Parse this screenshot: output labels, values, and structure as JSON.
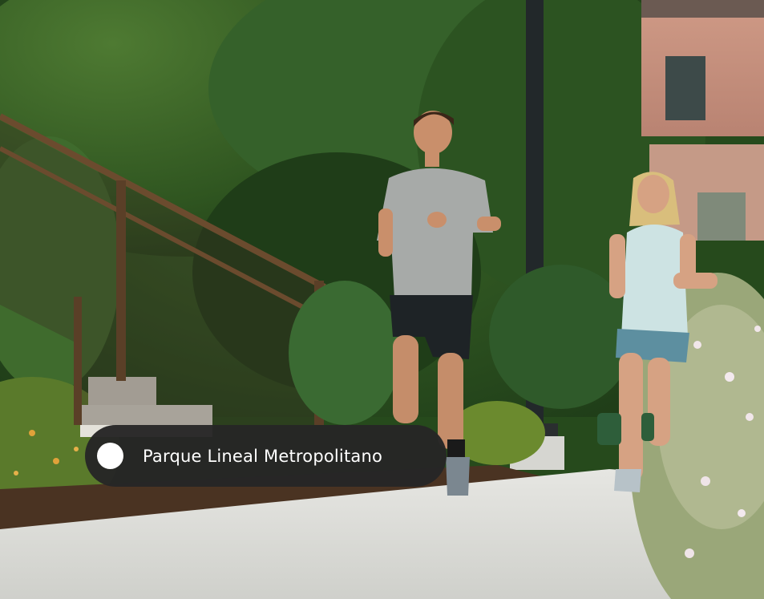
{
  "photo": {
    "scene": "runners-on-park-path"
  },
  "location_chip": {
    "label": "Parque Lineal Metropolitano",
    "dot_color": "#ffffff",
    "background_color": "#262626"
  }
}
